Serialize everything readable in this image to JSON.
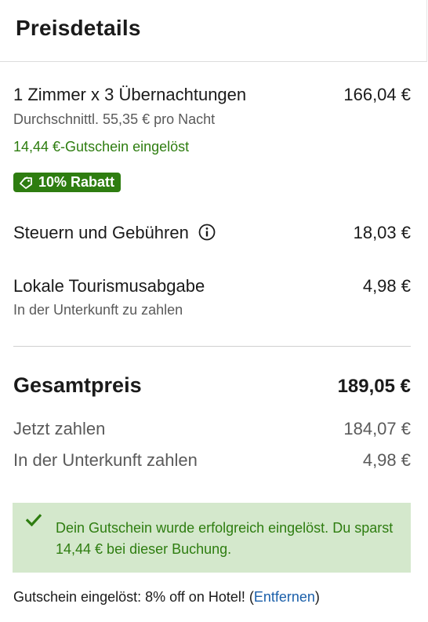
{
  "header": {
    "title": "Preisdetails"
  },
  "rooms": {
    "label": "1 Zimmer x 3 Übernachtungen",
    "amount": "166,04 €",
    "avg": "Durchschnittl. 55,35 € pro Nacht",
    "voucher_applied": "14,44 €-Gutschein eingelöst",
    "discount_badge": "10% Rabatt"
  },
  "taxes": {
    "label": "Steuern und Gebühren",
    "amount": "18,03 €"
  },
  "tourism": {
    "label": "Lokale Tourismusabgabe",
    "amount": "4,98 €",
    "note": "In der Unterkunft zu zahlen"
  },
  "total": {
    "label": "Gesamtpreis",
    "amount": "189,05 €"
  },
  "pay_now": {
    "label": "Jetzt zahlen",
    "amount": "184,07 €"
  },
  "pay_property": {
    "label": "In der Unterkunft zahlen",
    "amount": "4,98 €"
  },
  "alert": {
    "message": "Dein Gutschein wurde erfolgreich eingelöst. Du sparst 14,44 € bei dieser Buchung."
  },
  "footer": {
    "prefix": "Gutschein eingelöst: 8% off on Hotel! (",
    "remove_link": "Entfernen",
    "suffix": ")"
  },
  "colors": {
    "accent_green": "#2e7d10",
    "alert_bg": "#d4e8cc",
    "link_blue": "#1a5faa"
  }
}
